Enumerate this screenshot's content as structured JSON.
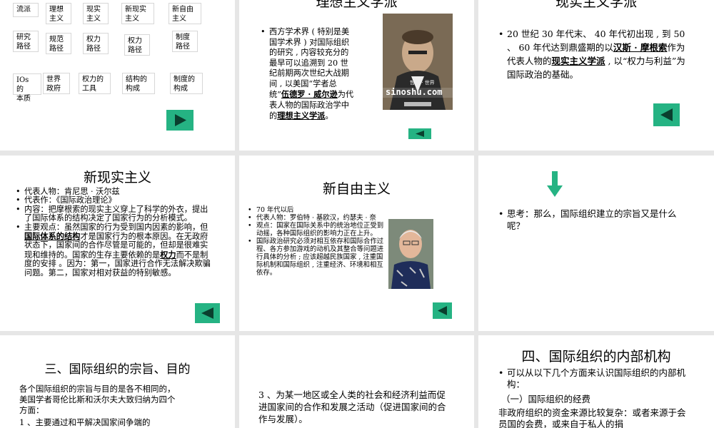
{
  "slide1": {
    "grid": [
      [
        "流派",
        "理想\n主义",
        "现实\n主义",
        "新现实\n主义",
        "新自由\n主义"
      ],
      [
        "研究\n路径",
        "规范\n路径",
        "权力\n路径",
        "权力\n路径",
        "制度\n路径"
      ],
      [
        "IOs 的\n本质",
        "世界\n政府",
        "权力的\n工具",
        "结构的\n构成",
        "制度的\n构成"
      ]
    ],
    "nav_icon": "play-right-icon"
  },
  "slide2": {
    "title": "理想主义学派",
    "bullet": {
      "before": "西方学术界 ( 特别是美国学术界 ) 对国际组织的研究 , 内容较充分的最早可以追溯到 20 世纪前期两次世纪大战期间 , 以美国“学者总统”",
      "h1": "伍德罗 · 威尔逊",
      "mid": "为代表人物的国际政治学中的",
      "h2": "理想主义学派",
      "after": "。"
    },
    "photo_caption": "sinoshu.com",
    "photo_top": "哲学 · 世界",
    "nav_icon": "play-left-icon"
  },
  "slide3": {
    "title": "现实主义学派",
    "bullet": {
      "before": "20 世纪 30 年代末、 40 年代初出现 , 到 50 、 60 年代达到鼎盛期的以",
      "h1": "汉斯 · 摩根索",
      "mid": "作为代表人物的",
      "h2": "现实主义学派",
      "after": " , 以“权力与利益”为国际政治的基础。"
    },
    "nav_icon": "play-left-icon"
  },
  "slide4": {
    "title": "新现实主义",
    "items": [
      {
        "text": "代表人物：肯尼思 · 沃尔兹"
      },
      {
        "text": "代表作：《国际政治理论》"
      },
      {
        "text": "内容：把摩根索的现实主义穿上了科学的外衣，提出了国际体系的结构决定了国家行为的分析模式。"
      }
    ],
    "last": {
      "before": "主要观点：虽然国家的行为受到国内因素的影响，但",
      "h1": "国际体系的结构",
      "mid": "才是国家行为的根本原因。在无政府状态下，国家间的合作尽管是可能的，但却是很难实现和维持的。国家的生存主要依赖的是",
      "h2": "权力",
      "after": "而不是制度的安排 。因为：第一，国家进行合作无法解决欺骗问题。第二，国家对相对获益的特别敏感。"
    },
    "nav_icon": "play-left-icon"
  },
  "slide5": {
    "title": "新自由主义",
    "items": [
      "70 年代以后",
      "代表人物：罗伯特 · 基欧汉，约瑟夫 · 奈",
      "观点：国家在国际关系中的统治地位正受到动摇，各种国际组织的影响力正在上升。",
      "国际政治研究必须对相互依存和国际合作过程、各方参加游戏的动机及其整合等问题进行具体的分析 ; 应该超越民族国家 , 注重国际机制和国际组织 , 注重经济、环境和相互依存。"
    ],
    "nav_icon": "play-left-icon"
  },
  "slide6": {
    "arrow_icon": "down-arrow-icon",
    "bullet": "思考：那么，国际组织建立的宗旨又是什么呢？"
  },
  "slide7": {
    "title": "三、国际组织的宗旨、目的",
    "lines": [
      "各个国际组织的宗旨与目的是各不相同的，美国学者哥伦比斯和沃尔夫大致归纳为四个方面：",
      "1 、主要通过和平解决国家间争端的"
    ]
  },
  "slide8": {
    "text": "3 、为某一地区或全人类的社会和经济利益而促进国家间的合作和发展之活动（促进国家间的合作与发展）。"
  },
  "slide9": {
    "title": "四、国际组织的内部机构",
    "bullet": "可以从以下几个方面来认识国际组织的内部机构：",
    "sub": "（一）国际组织的经费",
    "para": "非政府组织的资金来源比较复杂：或者来源于会员国的会费，或来自于私人的捐"
  }
}
